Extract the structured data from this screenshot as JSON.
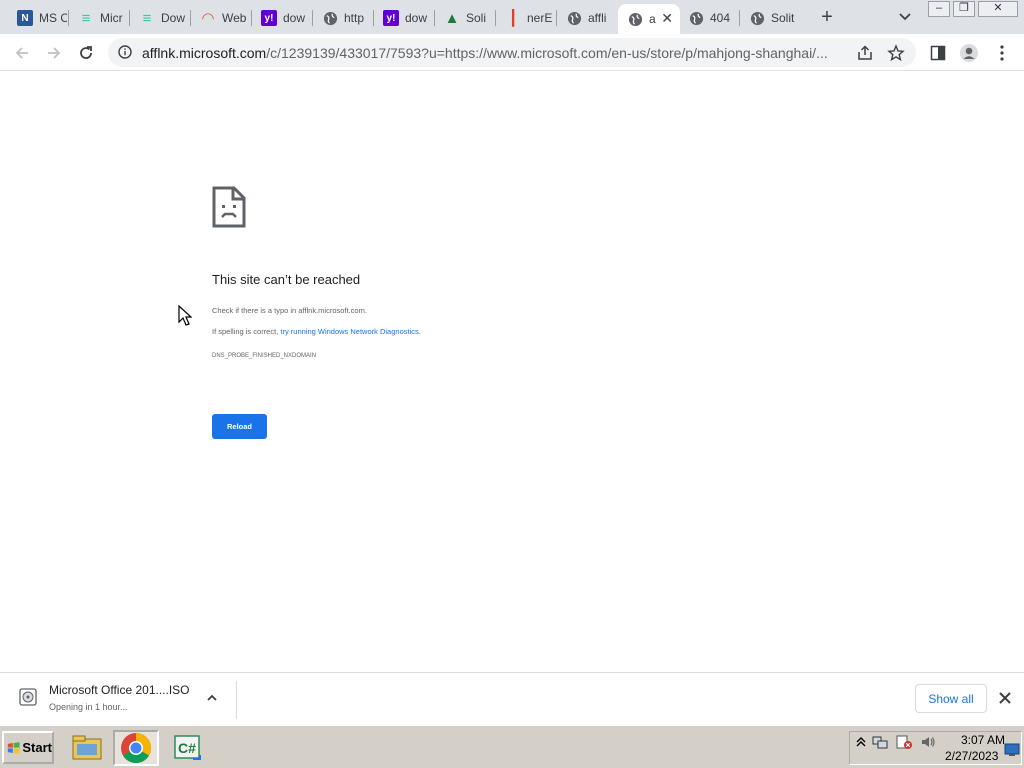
{
  "browser": {
    "tabs": [
      {
        "title": "MS O",
        "icon": "ms-docs-icon",
        "color": "#2b579a"
      },
      {
        "title": "Micr",
        "icon": "f-logo-icon",
        "color": "#3ec6a8"
      },
      {
        "title": "Dow",
        "icon": "f-logo-icon",
        "color": "#3ec6a8"
      },
      {
        "title": "Web",
        "icon": "rainbow-icon",
        "color": "#e05d44"
      },
      {
        "title": "dow",
        "icon": "yahoo-icon",
        "color": "#6001d2"
      },
      {
        "title": "http",
        "icon": "globe-icon",
        "color": "#5f6368"
      },
      {
        "title": "dow",
        "icon": "yahoo-icon",
        "color": "#6001d2"
      },
      {
        "title": "Soli",
        "icon": "tree-icon",
        "color": "#1e7b3a"
      },
      {
        "title": "nerE",
        "icon": "bars-icon",
        "color": "#e0402c"
      },
      {
        "title": "affli",
        "icon": "globe-icon",
        "color": "#5f6368"
      },
      {
        "title": "a",
        "icon": "globe-icon",
        "color": "#5f6368",
        "active": true
      },
      {
        "title": "404",
        "icon": "globe-icon",
        "color": "#5f6368"
      },
      {
        "title": "Solit",
        "icon": "globe-icon",
        "color": "#5f6368"
      }
    ],
    "new_tab_label": "+",
    "url_host": "afflnk.microsoft.com",
    "url_rest": "/c/1239139/433017/7593?u=https://www.microsoft.com/en-us/store/p/mahjong-shanghai/..."
  },
  "error_page": {
    "heading": "This site can’t be reached",
    "line1": "Check if there is a typo in afflnk.microsoft.com.",
    "line2_prefix": "If spelling is correct, ",
    "line2_link": "try running Windows Network Diagnostics",
    "line2_suffix": ".",
    "error_code": "DNS_PROBE_FINISHED_NXDOMAIN",
    "reload_label": "Reload"
  },
  "downloads": {
    "file_name": "Microsoft Office 201....ISO",
    "status": "Opening in 1 hour...",
    "show_all_label": "Show all"
  },
  "taskbar": {
    "start_label": "Start",
    "time": "3:07 AM",
    "date": "2/27/2023"
  },
  "colors": {
    "accent": "#1a73e8",
    "tab_strip": "#dee1e6",
    "taskbar": "#d4d0c8"
  }
}
